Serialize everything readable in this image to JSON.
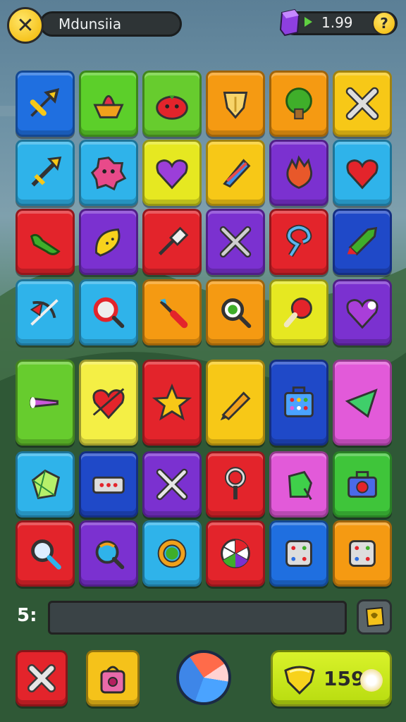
{
  "header": {
    "title": "Mdunsiia",
    "score": "1.99",
    "help_glyph": "?",
    "close_glyph": "✕"
  },
  "grid": {
    "rows": [
      [
        {
          "color": "#1f6fe0",
          "icon": "dart-icon"
        },
        {
          "color": "#5ccf2a",
          "icon": "cake-icon"
        },
        {
          "color": "#67cc2e",
          "icon": "tomato-icon"
        },
        {
          "color": "#f59a12",
          "icon": "shield-icon"
        },
        {
          "color": "#f59a12",
          "icon": "broccoli-icon"
        },
        {
          "color": "#f7c817",
          "icon": "cross-tools-icon"
        }
      ],
      [
        {
          "color": "#2fb3ea",
          "icon": "arrow-icon"
        },
        {
          "color": "#2fb3ea",
          "icon": "monster-icon"
        },
        {
          "color": "#e6e821",
          "icon": "purple-heart-icon"
        },
        {
          "color": "#f7c817",
          "icon": "feather-icon"
        },
        {
          "color": "#7b31d0",
          "icon": "flame-icon"
        },
        {
          "color": "#2fb3ea",
          "icon": "heart-icon"
        }
      ],
      [
        {
          "color": "#e3242b",
          "icon": "pepper-icon"
        },
        {
          "color": "#7b31d0",
          "icon": "leaf-icon"
        },
        {
          "color": "#e3242b",
          "icon": "brush-icon"
        },
        {
          "color": "#7b31d0",
          "icon": "crossed-swords-icon"
        },
        {
          "color": "#e3242b",
          "icon": "hook-icon"
        },
        {
          "color": "#1f49c8",
          "icon": "rocket-icon"
        }
      ],
      [
        {
          "color": "#2fb3ea",
          "icon": "bow-icon"
        },
        {
          "color": "#2fb3ea",
          "icon": "magnifier-icon"
        },
        {
          "color": "#f59a12",
          "icon": "screwdriver-icon"
        },
        {
          "color": "#f59a12",
          "icon": "loupe-icon"
        },
        {
          "color": "#e6e821",
          "icon": "paddle-icon"
        },
        {
          "color": "#7b31d0",
          "icon": "cracked-heart-icon"
        }
      ],
      [
        {
          "color": "#67cc2e",
          "icon": "cone-icon"
        },
        {
          "color": "#f4ef45",
          "icon": "heart-arrow-icon"
        },
        {
          "color": "#e3242b",
          "icon": "star-icon"
        },
        {
          "color": "#f7c817",
          "icon": "pencil-icon"
        },
        {
          "color": "#1f49c8",
          "icon": "keypad-icon"
        },
        {
          "color": "#e25ad9",
          "icon": "triangle-gem-icon"
        }
      ],
      [
        {
          "color": "#2fb3ea",
          "icon": "crystal-icon"
        },
        {
          "color": "#1f49c8",
          "icon": "radio-icon"
        },
        {
          "color": "#7b31d0",
          "icon": "wrench-cross-icon"
        },
        {
          "color": "#e3242b",
          "icon": "key-icon"
        },
        {
          "color": "#e25ad9",
          "icon": "green-cube-icon"
        },
        {
          "color": "#3fc53a",
          "icon": "camera-icon"
        }
      ],
      [
        {
          "color": "#e3242b",
          "icon": "search-icon"
        },
        {
          "color": "#7b31d0",
          "icon": "orb-icon"
        },
        {
          "color": "#2fb3ea",
          "icon": "ring-icon"
        },
        {
          "color": "#e3242b",
          "icon": "beach-ball-icon"
        },
        {
          "color": "#1f6fe0",
          "icon": "dice-icon"
        },
        {
          "color": "#f59a12",
          "icon": "dice-icon"
        }
      ]
    ]
  },
  "bottom": {
    "row_label": "5:",
    "input_value": "",
    "coin_count": "159"
  }
}
